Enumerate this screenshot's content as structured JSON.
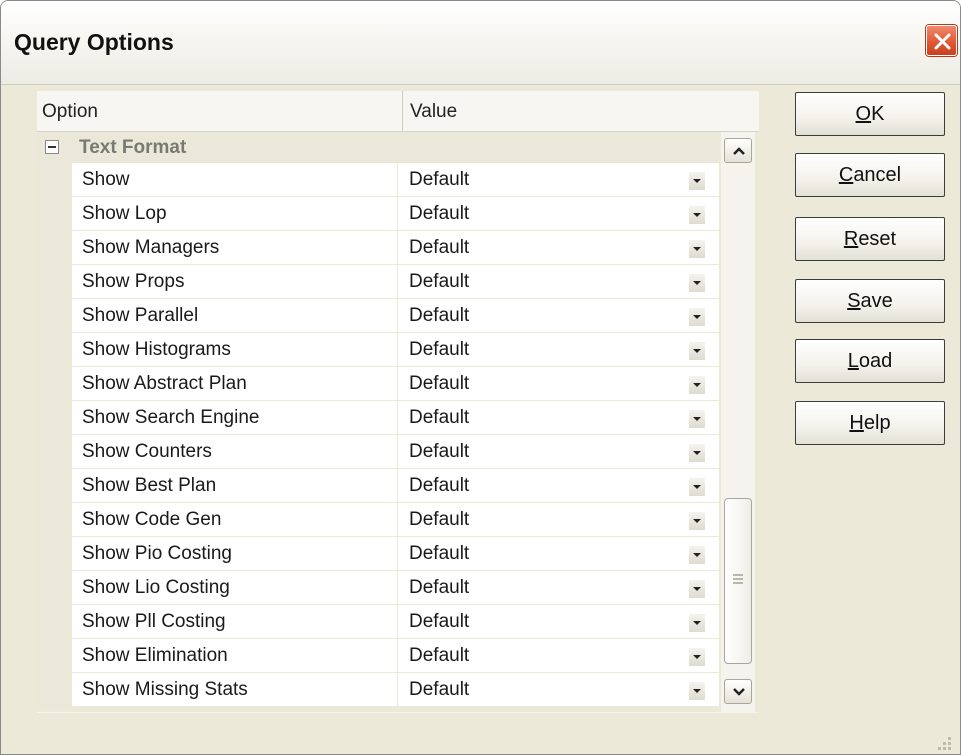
{
  "window": {
    "title": "Query Options"
  },
  "grid": {
    "columns": {
      "option": "Option",
      "value": "Value"
    },
    "category": {
      "label": "Text Format"
    },
    "rows": [
      {
        "name": "Show",
        "value": "Default"
      },
      {
        "name": "Show Lop",
        "value": "Default"
      },
      {
        "name": "Show Managers",
        "value": "Default"
      },
      {
        "name": "Show Props",
        "value": "Default"
      },
      {
        "name": "Show Parallel",
        "value": "Default"
      },
      {
        "name": "Show Histograms",
        "value": "Default"
      },
      {
        "name": "Show Abstract Plan",
        "value": "Default"
      },
      {
        "name": "Show Search Engine",
        "value": "Default"
      },
      {
        "name": "Show Counters",
        "value": "Default"
      },
      {
        "name": "Show Best Plan",
        "value": "Default"
      },
      {
        "name": "Show Code Gen",
        "value": "Default"
      },
      {
        "name": "Show Pio Costing",
        "value": "Default"
      },
      {
        "name": "Show Lio Costing",
        "value": "Default"
      },
      {
        "name": "Show Pll Costing",
        "value": "Default"
      },
      {
        "name": "Show Elimination",
        "value": "Default"
      },
      {
        "name": "Show Missing Stats",
        "value": "Default"
      }
    ]
  },
  "buttons": {
    "ok": {
      "mnemonic": "O",
      "rest": "K"
    },
    "cancel": {
      "mnemonic": "C",
      "rest": "ancel"
    },
    "reset": {
      "mnemonic": "R",
      "rest": "eset"
    },
    "save": {
      "mnemonic": "S",
      "rest": "ave"
    },
    "load": {
      "mnemonic": "L",
      "rest": "oad"
    },
    "help": {
      "mnemonic": "H",
      "rest": "elp"
    }
  },
  "icons": {
    "close": "close-icon",
    "collapse": "minus-box-icon",
    "dropdown": "chevron-down-icon",
    "scroll_up": "chevron-up-icon",
    "scroll_down": "chevron-down-icon"
  },
  "colors": {
    "close_button": "#e05a36",
    "window_bg": "#ece9d8"
  }
}
